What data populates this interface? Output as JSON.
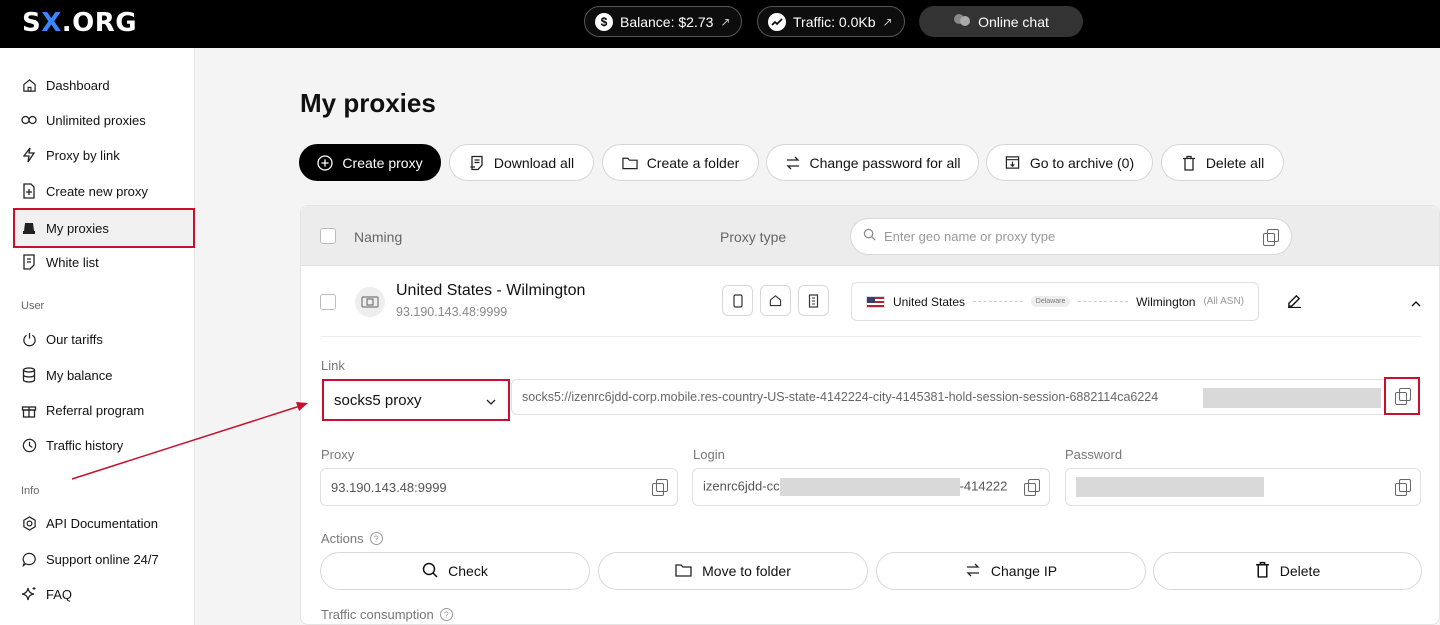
{
  "brand": {
    "logo_left": "S",
    "logo_x": "X",
    "logo_right": ".ORG"
  },
  "topbar": {
    "balance": "Balance: $2.73",
    "traffic": "Traffic: 0.0Kb",
    "chat": "Online chat"
  },
  "sidebar": {
    "items": [
      {
        "label": "Dashboard"
      },
      {
        "label": "Unlimited proxies"
      },
      {
        "label": "Proxy by link"
      },
      {
        "label": "Create new proxy"
      },
      {
        "label": "My proxies"
      },
      {
        "label": "White list"
      }
    ],
    "section_user": "User",
    "user_items": [
      {
        "label": "Our tariffs"
      },
      {
        "label": "My balance"
      },
      {
        "label": "Referral program"
      },
      {
        "label": "Traffic history"
      }
    ],
    "section_info": "Info",
    "info_items": [
      {
        "label": "API Documentation"
      },
      {
        "label": "Support online 24/7"
      },
      {
        "label": "FAQ"
      }
    ]
  },
  "main": {
    "title": "My proxies",
    "toolbar": {
      "create": "Create proxy",
      "download": "Download all",
      "folder": "Create a folder",
      "change_password": "Change password for all",
      "archive": "Go to archive (0)",
      "delete_all": "Delete all"
    },
    "table": {
      "col_naming": "Naming",
      "col_type": "Proxy type",
      "search_placeholder": "Enter geo name or proxy type"
    },
    "proxy": {
      "name": "United States - Wilmington",
      "address": "93.190.143.48:9999",
      "country": "United States",
      "state": "Delaware",
      "city": "Wilmington",
      "asn": "(All ASN)",
      "link_label": "Link",
      "protocol": "socks5 proxy",
      "link": "socks5://izenrc6jdd-corp.mobile.res-country-US-state-4142224-city-4145381-hold-session-session-6882114ca6224",
      "proxy_label": "Proxy",
      "proxy_value": "93.190.143.48:9999",
      "login_label": "Login",
      "login_start": "izenrc6jdd-cc",
      "login_end": "-414222",
      "password_label": "Password",
      "actions_label": "Actions",
      "check": "Check",
      "move": "Move to folder",
      "change_ip": "Change IP",
      "delete": "Delete",
      "traffic_label": "Traffic consumption"
    }
  },
  "colors": {
    "accent_red": "#c8102e",
    "brand_blue": "#3a86ff"
  }
}
